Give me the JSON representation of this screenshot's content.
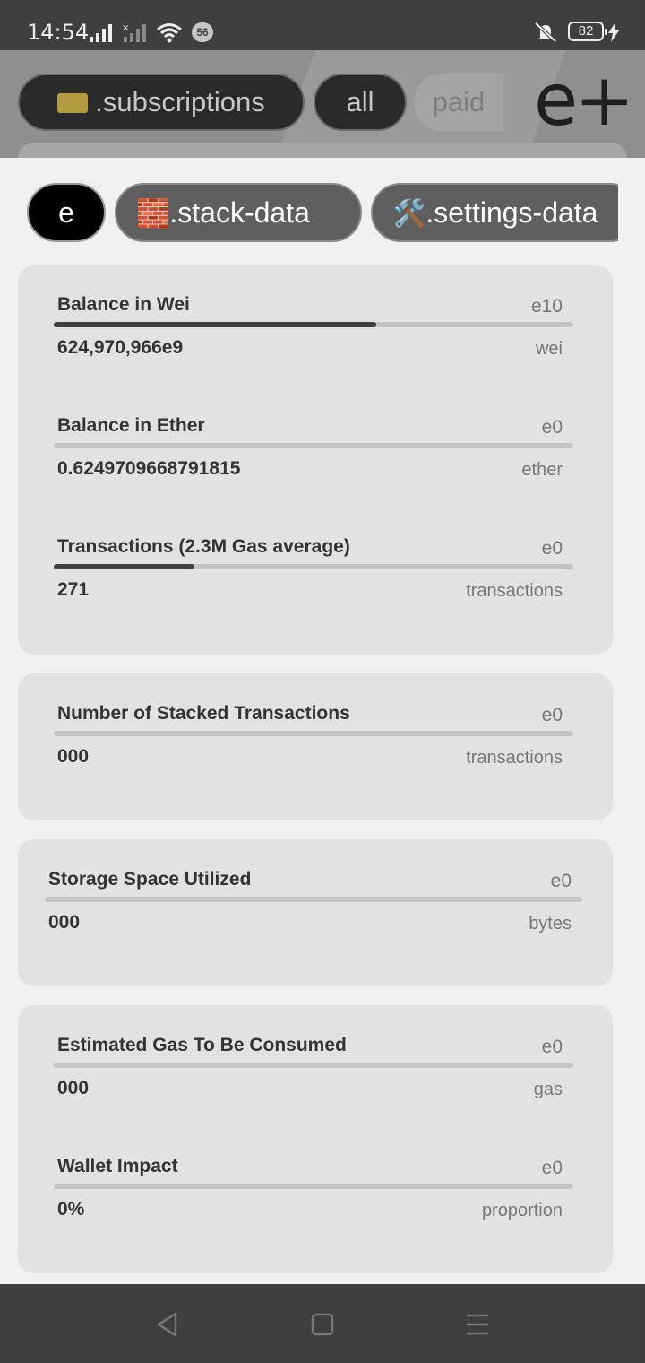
{
  "status_bar": {
    "time": "14:54",
    "notification_count": "56",
    "battery": "82"
  },
  "top_bar": {
    "tabs": [
      {
        "icon": "ticket-icon",
        "label": ".subscriptions"
      },
      {
        "label": "all"
      },
      {
        "label": "paid"
      }
    ],
    "logo": "e+"
  },
  "sheet": {
    "chips": [
      {
        "label": "e"
      },
      {
        "icon": "🧱",
        "label": ".stack-data"
      },
      {
        "icon": "🛠️",
        "label": ".settings-data"
      }
    ],
    "cards": [
      {
        "metrics": [
          {
            "label": "Balance in Wei",
            "exponent": "e10",
            "value": "624,970,966e9",
            "unit": "wei",
            "progress": 0.62
          },
          {
            "label": "Balance in Ether",
            "exponent": "e0",
            "value": "0.6249709668791815",
            "unit": "ether",
            "progress": 0
          },
          {
            "label": "Transactions (2.3M Gas average)",
            "exponent": "e0",
            "value": "271",
            "unit": "transactions",
            "progress": 0.27
          }
        ]
      },
      {
        "metrics": [
          {
            "label": "Number of Stacked Transactions",
            "exponent": "e0",
            "value": "000",
            "unit": "transactions",
            "progress": 0
          }
        ]
      },
      {
        "metrics": [
          {
            "label": "Storage Space Utilized",
            "exponent": "e0",
            "value": "000",
            "unit": "bytes",
            "progress": 0
          }
        ]
      },
      {
        "metrics": [
          {
            "label": "Estimated Gas To Be Consumed",
            "exponent": "e0",
            "value": "000",
            "unit": "gas",
            "progress": 0
          },
          {
            "label": "Wallet Impact",
            "exponent": "e0",
            "value": "0%",
            "unit": "proportion",
            "progress": 0
          }
        ]
      }
    ]
  },
  "colors": {
    "status_bar_bg": "#3f3f3f",
    "sheet_bg": "#f0f0f0",
    "card_bg": "#e2e2e2",
    "progress_fill": "#3f3f3f",
    "progress_track": "#c4c4c4"
  }
}
